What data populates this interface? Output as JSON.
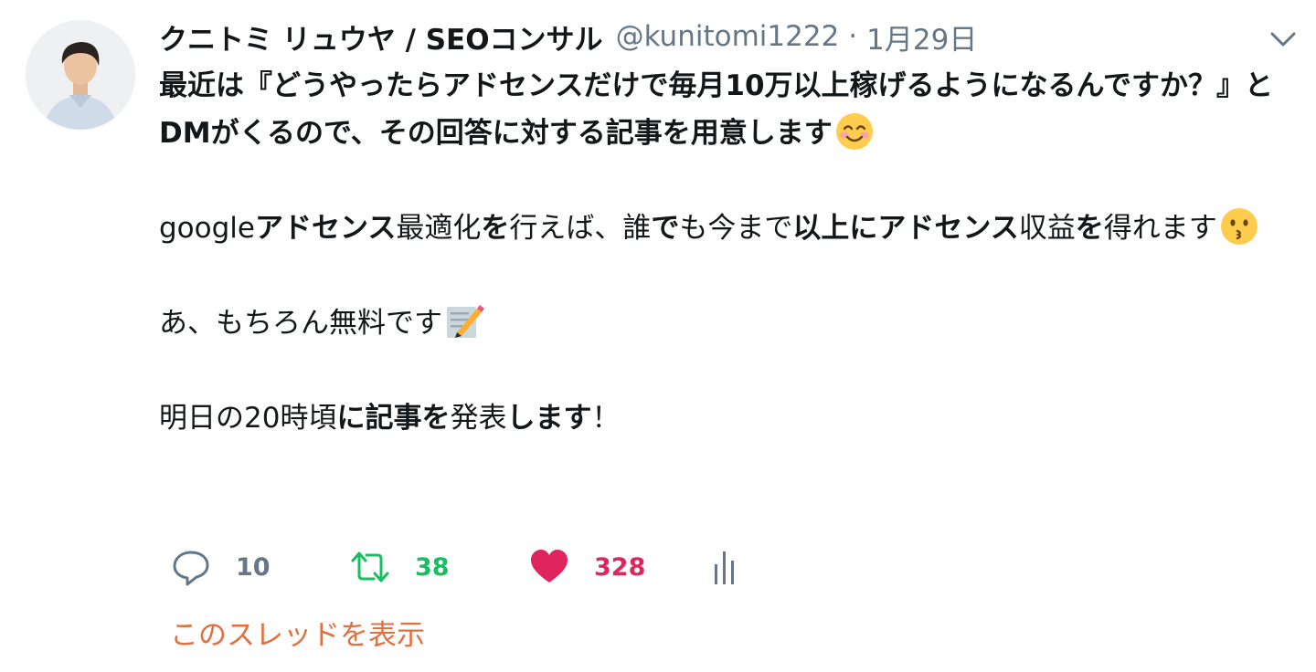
{
  "tweet": {
    "author": {
      "name": "クニトミ リュウヤ / SEOコンサル",
      "handle": "@kunitomi1222"
    },
    "separator": "·",
    "date": "1月29日",
    "body": {
      "p1": {
        "t1": "最近は『どうやったらアドセンスだけで毎月10万以上稼げるようになるんですか？』とDMがくるので、その回答に対する記事を用意します"
      },
      "p2": {
        "t1": "google",
        "t2": "アドセンス",
        "t3": "最適化",
        "t4": "を",
        "t5": "行えば、誰",
        "t6": "で",
        "t7": "も今まで",
        "t8": "以上にアドセンス",
        "t9": "収益",
        "t10": "を",
        "t11": "得れます"
      },
      "p3": {
        "t1": "あ、もちろん無料です"
      },
      "p4": {
        "t1": "明日の20時頃",
        "t2": "に記事を",
        "t3": "発表",
        "t4": "します",
        "t5": "！"
      }
    },
    "emojis": {
      "p1": "smiling-face-icon",
      "p2": "kissing-face-icon",
      "p3": "memo-pencil-icon"
    },
    "actions": {
      "reply": {
        "count": "10",
        "icon": "reply-icon"
      },
      "retweet": {
        "count": "38",
        "icon": "retweet-icon"
      },
      "like": {
        "count": "328",
        "icon": "heart-icon"
      },
      "analytics": {
        "icon": "analytics-icon"
      }
    },
    "show_thread": "このスレッドを表示"
  },
  "colors": {
    "text": "#14171a",
    "secondary": "#657786",
    "retweet": "#17bf63",
    "like": "#e0245e",
    "thread_link": "#e0703f"
  }
}
